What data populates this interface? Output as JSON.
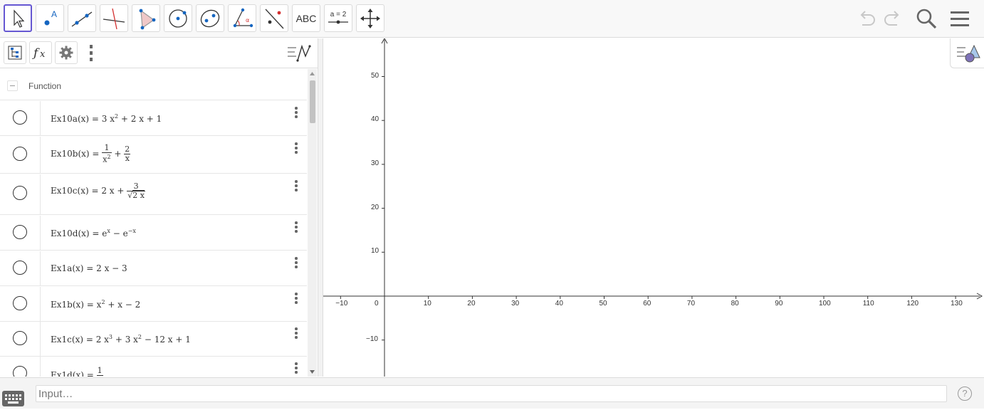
{
  "toolbar": {
    "tools": [
      {
        "id": "move",
        "label": "",
        "icon": "cursor-arrow-icon"
      },
      {
        "id": "point",
        "label": "A",
        "icon": "point-icon"
      },
      {
        "id": "line",
        "label": "",
        "icon": "line-icon"
      },
      {
        "id": "perpendicular",
        "label": "",
        "icon": "perpendicular-line-icon"
      },
      {
        "id": "polygon",
        "label": "",
        "icon": "polygon-icon"
      },
      {
        "id": "circle",
        "label": "",
        "icon": "circle-icon"
      },
      {
        "id": "ellipse",
        "label": "",
        "icon": "ellipse-icon"
      },
      {
        "id": "angle",
        "label": "",
        "icon": "angle-icon"
      },
      {
        "id": "reflect",
        "label": "",
        "icon": "reflect-icon"
      },
      {
        "id": "text",
        "label": "ABC",
        "icon": "text-tool-icon"
      },
      {
        "id": "slider",
        "label": "a = 2",
        "icon": "slider-icon"
      },
      {
        "id": "move-graphics",
        "label": "",
        "icon": "move-graphics-icon"
      }
    ],
    "undo_icon": "undo-icon",
    "redo_icon": "redo-icon",
    "search_icon": "search-icon",
    "menu_icon": "hamburger-menu-icon"
  },
  "algebra": {
    "group_label": "Function",
    "items": [
      {
        "name": "Ex10a(x)",
        "formula_plain": "3 x² + 2 x + 1"
      },
      {
        "name": "Ex10b(x)",
        "formula_plain": "1/x² + 2/x"
      },
      {
        "name": "Ex10c(x)",
        "formula_plain": "2 x + 3/√(2 x)"
      },
      {
        "name": "Ex10d(x)",
        "formula_plain": "eˣ − e⁻ˣ"
      },
      {
        "name": "Ex1a(x)",
        "formula_plain": "2 x − 3"
      },
      {
        "name": "Ex1b(x)",
        "formula_plain": "x² + x − 2"
      },
      {
        "name": "Ex1c(x)",
        "formula_plain": "2 x³ + 3 x² − 12 x + 1"
      },
      {
        "name": "Ex1d(x)",
        "formula_plain": "1/…"
      }
    ]
  },
  "graphics": {
    "x_ticks": [
      -10,
      0,
      10,
      20,
      30,
      40,
      50,
      60,
      70,
      80,
      90,
      100,
      110,
      120,
      130
    ],
    "y_ticks": [
      50,
      40,
      30,
      20,
      10,
      -10
    ]
  },
  "input_bar": {
    "placeholder": "Input…",
    "help_label": "?"
  },
  "colors": {
    "accent": "#6557d2",
    "point_blue": "#1565c0",
    "toolbar_bg": "#f8f8f8"
  }
}
